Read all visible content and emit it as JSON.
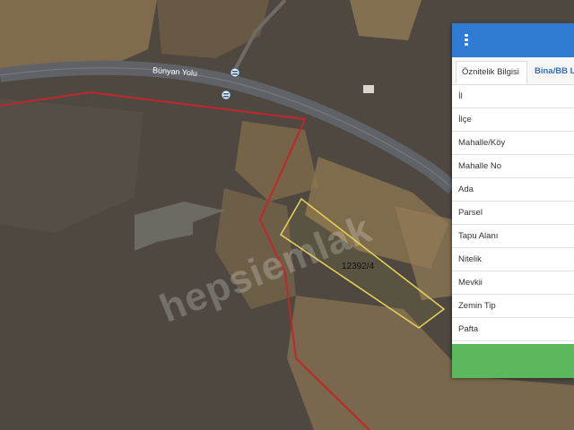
{
  "map": {
    "road_label": "Bünyan Yolu",
    "parcel_label": "12392/4",
    "watermark": "hepsiemlak",
    "colors": {
      "ground": "#4e4841",
      "field": "#8a7350",
      "road": "#5f6367",
      "boundary": "#c0272d",
      "parcel_outline": "#e8d45a"
    }
  },
  "panel": {
    "menu_icon": "vertical-ellipsis-icon",
    "tabs": [
      {
        "label": "Öznitelik Bilgisi"
      },
      {
        "label": "Bina/BB Listesi"
      }
    ],
    "attributes": [
      {
        "label": "İl"
      },
      {
        "label": "İlçe"
      },
      {
        "label": "Mahalle/Köy"
      },
      {
        "label": "Mahalle No"
      },
      {
        "label": "Ada"
      },
      {
        "label": "Parsel"
      },
      {
        "label": "Tapu Alanı"
      },
      {
        "label": "Nitelik"
      },
      {
        "label": "Mevkii"
      },
      {
        "label": "Zemin Tip"
      },
      {
        "label": "Pafta"
      }
    ],
    "colors": {
      "header": "#2f7bd3",
      "footer": "#5cb85c"
    }
  }
}
